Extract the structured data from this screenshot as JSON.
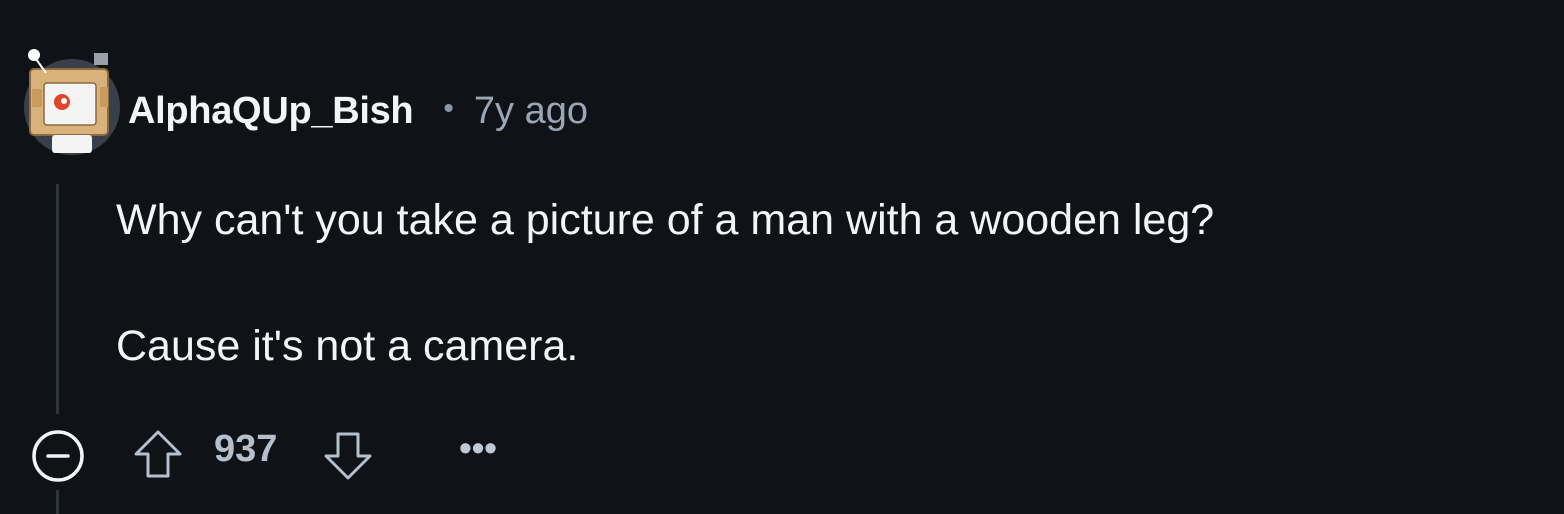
{
  "comment": {
    "author": "AlphaQUp_Bish",
    "separator": "•",
    "timestamp": "7y ago",
    "body": {
      "line1": "Why can't you take a picture of a man with a wooden leg?",
      "line2": "Cause it's not a camera."
    }
  },
  "actions": {
    "score": "937",
    "more_label": "•••",
    "collapse_icon": "minus-circle-icon",
    "upvote_icon": "arrow-up-outline-icon",
    "downvote_icon": "arrow-down-outline-icon"
  },
  "colors": {
    "background": "#0f1217",
    "text_primary": "#f2f4f5",
    "text_secondary": "#9aa6b4",
    "thread_line": "#2f3540"
  }
}
